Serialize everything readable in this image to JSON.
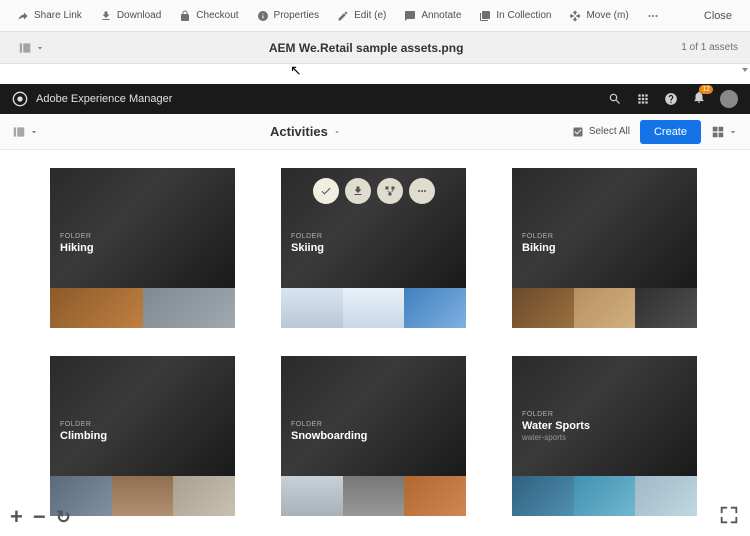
{
  "toolbar": {
    "share": "Share Link",
    "download": "Download",
    "checkout": "Checkout",
    "properties": "Properties",
    "edit": "Edit (e)",
    "annotate": "Annotate",
    "inCollection": "In Collection",
    "move": "Move (m)",
    "close": "Close"
  },
  "titleBar": {
    "fileName": "AEM We.Retail sample assets.png",
    "pageInfo": "1 of 1 assets"
  },
  "aemHeader": {
    "brand": "Adobe Experience Manager",
    "notifCount": "12"
  },
  "sectionBar": {
    "title": "Activities",
    "selectAll": "Select All",
    "createBtn": "Create"
  },
  "folders": [
    {
      "type": "FOLDER",
      "name": "Hiking",
      "thumbs": [
        "t-hiking-0",
        "t-hiking-1"
      ]
    },
    {
      "type": "FOLDER",
      "name": "Skiing",
      "hovered": true,
      "thumbs": [
        "t-skiing-0",
        "t-skiing-1",
        "t-skiing-2"
      ]
    },
    {
      "type": "FOLDER",
      "name": "Biking",
      "thumbs": [
        "t-biking-0",
        "t-biking-1",
        "t-biking-2"
      ]
    },
    {
      "type": "FOLDER",
      "name": "Climbing",
      "thumbs": [
        "t-climbing-0",
        "t-climbing-1",
        "t-climbing-2"
      ]
    },
    {
      "type": "FOLDER",
      "name": "Snowboarding",
      "thumbs": [
        "t-snow-0",
        "t-snow-1",
        "t-snow-2"
      ]
    },
    {
      "type": "FOLDER",
      "name": "Water Sports",
      "sub": "water-sports",
      "thumbs": [
        "t-water-0",
        "t-water-1",
        "t-water-2"
      ]
    }
  ]
}
